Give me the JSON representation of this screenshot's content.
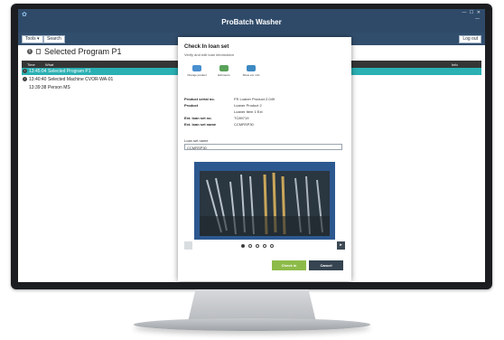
{
  "app": {
    "logo": "✿",
    "sysline": "",
    "title": "ProBatch Washer",
    "window_controls": "— ☐ ✕",
    "window_controls2": "—"
  },
  "toolbar": {
    "tools_label": "Tools ▾",
    "search_label": "Search",
    "logout_label": "Log out"
  },
  "program": {
    "title": "Selected Program P1"
  },
  "table": {
    "headers": {
      "time": "Time",
      "what": "What",
      "info": "Info"
    },
    "rows": [
      {
        "icon": "i",
        "time": "13:45:04",
        "what": "Selected Program P1",
        "selected": true
      },
      {
        "icon": "i",
        "time": "13:40:40",
        "what": "Selected Machine CVOR-WA-01",
        "selected": false
      },
      {
        "icon": "",
        "time": "13:39:38",
        "what": "Person MS",
        "selected": false
      }
    ]
  },
  "dialog": {
    "crumb": "",
    "title": "Check In loan set",
    "subtitle": "Verify and edit loan information",
    "actions": [
      {
        "label": "Change product",
        "icon": "product-icon"
      },
      {
        "label": "Edit items",
        "icon": "edit-icon"
      },
      {
        "label": "Show ext. info",
        "icon": "eye-icon"
      }
    ],
    "details": [
      {
        "key": "Product serial no.",
        "value": "PS Loaner Product 2-049"
      },
      {
        "key": "Product",
        "value": "Loaner Product 2"
      },
      {
        "key": "",
        "value": "Loaner Item 1 Ext"
      },
      {
        "key": "Ext. loan set no.",
        "value": "TC89719"
      },
      {
        "key": "Ext. loan set name",
        "value": "CCMRSP30"
      }
    ],
    "loan_set_label": "Loan set name",
    "loan_set_value": "CCMRSP30",
    "photo_alt": "instrument tray photo",
    "dots": 5,
    "active_dot": 0,
    "next_label": "▸",
    "checkin_label": "Check in",
    "cancel_label": "Cancel"
  },
  "colors": {
    "titlebar": "#2f4a69",
    "selected_row": "#2bb0b3",
    "checkin": "#8dbb49",
    "cancel": "#354450"
  }
}
